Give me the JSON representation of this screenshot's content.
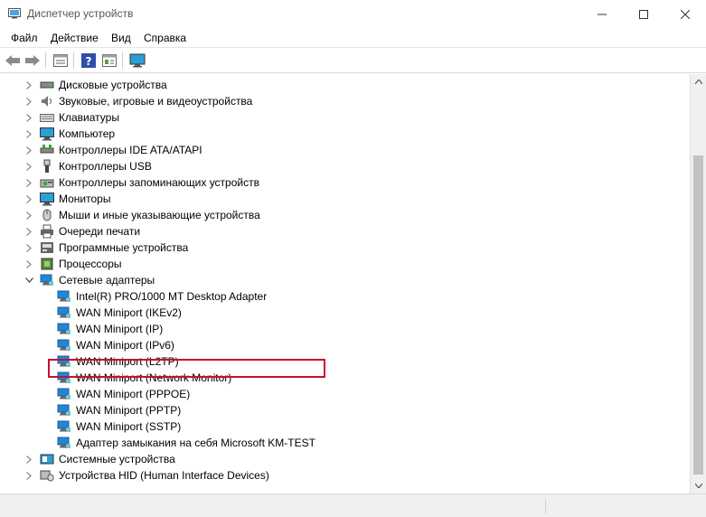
{
  "window": {
    "title": "Диспетчер устройств",
    "minimize_glyph": "—",
    "maximize_glyph": "☐",
    "close_glyph": "✕"
  },
  "menu": [
    "Файл",
    "Действие",
    "Вид",
    "Справка"
  ],
  "toolbar": {
    "buttons": [
      "back-arrow-icon",
      "forward-arrow-icon",
      "properties-icon",
      "help-icon",
      "view-icon",
      "monitor-scan-icon"
    ]
  },
  "tree": {
    "categories": [
      {
        "label": "Дисковые устройства",
        "icon": "disk-drive-icon",
        "expanded": false
      },
      {
        "label": "Звуковые, игровые и видеоустройства",
        "icon": "sound-icon",
        "expanded": false
      },
      {
        "label": "Клавиатуры",
        "icon": "keyboard-icon",
        "expanded": false
      },
      {
        "label": "Компьютер",
        "icon": "computer-icon",
        "expanded": false
      },
      {
        "label": "Контроллеры IDE ATA/ATAPI",
        "icon": "ide-controller-icon",
        "expanded": false
      },
      {
        "label": "Контроллеры USB",
        "icon": "usb-icon",
        "expanded": false
      },
      {
        "label": "Контроллеры запоминающих устройств",
        "icon": "storage-controller-icon",
        "expanded": false
      },
      {
        "label": "Мониторы",
        "icon": "monitor-icon",
        "expanded": false
      },
      {
        "label": "Мыши и иные указывающие устройства",
        "icon": "mouse-icon",
        "expanded": false
      },
      {
        "label": "Очереди печати",
        "icon": "printer-icon",
        "expanded": false
      },
      {
        "label": "Программные устройства",
        "icon": "software-device-icon",
        "expanded": false
      },
      {
        "label": "Процессоры",
        "icon": "processor-icon",
        "expanded": false
      },
      {
        "label": "Сетевые адаптеры",
        "icon": "network-adapter-icon",
        "expanded": true
      }
    ],
    "network_adapters": [
      "Intel(R) PRO/1000 MT Desktop Adapter",
      "WAN Miniport (IKEv2)",
      "WAN Miniport (IP)",
      "WAN Miniport (IPv6)",
      "WAN Miniport (L2TP)",
      "WAN Miniport (Network Monitor)",
      "WAN Miniport (PPPOE)",
      "WAN Miniport (PPTP)",
      "WAN Miniport (SSTP)",
      "Адаптер замыкания на себя Microsoft KM-TEST"
    ],
    "trailing_categories": [
      {
        "label": "Системные устройства",
        "icon": "system-device-icon",
        "expanded": false
      },
      {
        "label": "Устройства HID (Human Interface Devices)",
        "icon": "hid-icon",
        "expanded": false
      }
    ]
  },
  "colors": {
    "highlight_border": "#c8102e",
    "network_icon": "#1e88d8",
    "monitor_icon": "#2a9fd6"
  }
}
